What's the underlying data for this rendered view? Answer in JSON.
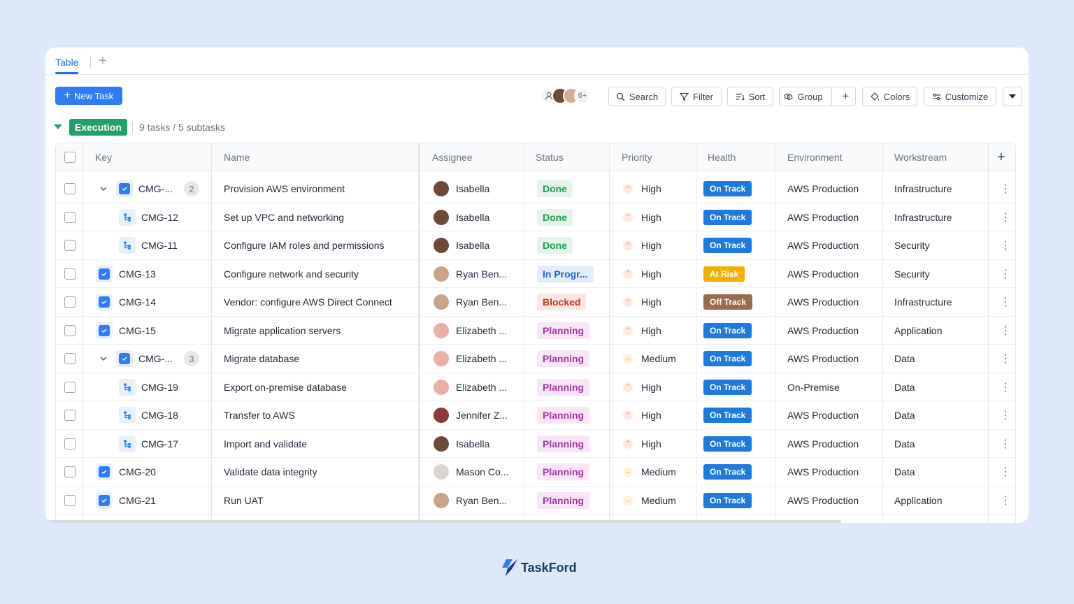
{
  "tabs": {
    "active": "Table",
    "add_label": "+"
  },
  "toolbar": {
    "new_task": "New Task",
    "avatar_more": "6+",
    "search": "Search",
    "filter": "Filter",
    "sort": "Sort",
    "group": "Group",
    "add": "+",
    "colors": "Colors",
    "customize": "Customize"
  },
  "group": {
    "name": "Execution",
    "summary": "9 tasks / 5 subtasks",
    "color": "#22a06b"
  },
  "columns": [
    "Key",
    "Name",
    "Assignee",
    "Status",
    "Priority",
    "Health",
    "Environment",
    "Workstream"
  ],
  "add_column": "+",
  "rows": [
    {
      "key": "CMG-...",
      "type": "parent",
      "subcount": "2",
      "name": "Provision AWS environment",
      "assignee": "Isabella",
      "avatar": "isabella",
      "status": "Done",
      "priority": "High",
      "health": "On Track",
      "environment": "AWS Production",
      "workstream": "Infrastructure"
    },
    {
      "key": "CMG-12",
      "type": "sub",
      "name": "Set up VPC and networking",
      "assignee": "Isabella",
      "avatar": "isabella",
      "status": "Done",
      "priority": "High",
      "health": "On Track",
      "environment": "AWS Production",
      "workstream": "Infrastructure"
    },
    {
      "key": "CMG-11",
      "type": "sub",
      "name": "Configure IAM roles and permissions",
      "assignee": "Isabella",
      "avatar": "isabella",
      "status": "Done",
      "priority": "High",
      "health": "On Track",
      "environment": "AWS Production",
      "workstream": "Security"
    },
    {
      "key": "CMG-13",
      "type": "task",
      "name": "Configure network and security",
      "assignee": "Ryan Ben...",
      "avatar": "ryan",
      "status": "In Progr...",
      "priority": "High",
      "health": "At Risk",
      "environment": "AWS Production",
      "workstream": "Security"
    },
    {
      "key": "CMG-14",
      "type": "task",
      "name": "Vendor: configure AWS Direct Connect",
      "assignee": "Ryan Ben...",
      "avatar": "ryan",
      "status": "Blocked",
      "priority": "High",
      "health": "Off Track",
      "environment": "AWS Production",
      "workstream": "Infrastructure"
    },
    {
      "key": "CMG-15",
      "type": "task",
      "name": "Migrate application servers",
      "assignee": "Elizabeth ...",
      "avatar": "elizabeth",
      "status": "Planning",
      "priority": "High",
      "health": "On Track",
      "environment": "AWS Production",
      "workstream": "Application"
    },
    {
      "key": "CMG-...",
      "type": "parent",
      "subcount": "3",
      "name": "Migrate database",
      "assignee": "Elizabeth ...",
      "avatar": "elizabeth",
      "status": "Planning",
      "priority": "Medium",
      "health": "On Track",
      "environment": "AWS Production",
      "workstream": "Data"
    },
    {
      "key": "CMG-19",
      "type": "sub",
      "name": "Export on-premise database",
      "assignee": "Elizabeth ...",
      "avatar": "elizabeth",
      "status": "Planning",
      "priority": "High",
      "health": "On Track",
      "environment": "On-Premise",
      "workstream": "Data"
    },
    {
      "key": "CMG-18",
      "type": "sub",
      "name": "Transfer to AWS",
      "assignee": "Jennifer Z...",
      "avatar": "jennifer",
      "status": "Planning",
      "priority": "High",
      "health": "On Track",
      "environment": "AWS Production",
      "workstream": "Data"
    },
    {
      "key": "CMG-17",
      "type": "sub",
      "name": "Import and validate",
      "assignee": "Isabella",
      "avatar": "isabella",
      "status": "Planning",
      "priority": "High",
      "health": "On Track",
      "environment": "AWS Production",
      "workstream": "Data"
    },
    {
      "key": "CMG-20",
      "type": "task",
      "name": "Validate data integrity",
      "assignee": "Mason Co...",
      "avatar": "mason",
      "status": "Planning",
      "priority": "Medium",
      "health": "On Track",
      "environment": "AWS Production",
      "workstream": "Data"
    },
    {
      "key": "CMG-21",
      "type": "task",
      "name": "Run UAT",
      "assignee": "Ryan Ben...",
      "avatar": "ryan",
      "status": "Planning",
      "priority": "Medium",
      "health": "On Track",
      "environment": "AWS Production",
      "workstream": "Application"
    }
  ],
  "status_colors": {
    "Done": {
      "bg": "#e3f5ea",
      "fg": "#1f9d55"
    },
    "In Progr...": {
      "bg": "#e3eefd",
      "fg": "#2563c9"
    },
    "Blocked": {
      "bg": "#fde7e4",
      "fg": "#c0392b"
    },
    "Planning": {
      "bg": "#f8e6f6",
      "fg": "#a23ba0"
    }
  },
  "health_colors": {
    "On Track": "#1f7ae0",
    "At Risk": "#f5b000",
    "Off Track": "#9a6b4f"
  },
  "priority_colors": {
    "High": {
      "bg": "#fde9e2",
      "fg": "#e07a5f"
    },
    "Medium": {
      "bg": "#fdf3d8",
      "fg": "#e0a030"
    }
  },
  "avatar_colors": {
    "isabella": "#6b4a3a",
    "ryan": "#c8a58a",
    "elizabeth": "#e8b0a8",
    "jennifer": "#8a3b3b",
    "mason": "#d9d4cf"
  },
  "brand": {
    "name": "TaskFord"
  }
}
